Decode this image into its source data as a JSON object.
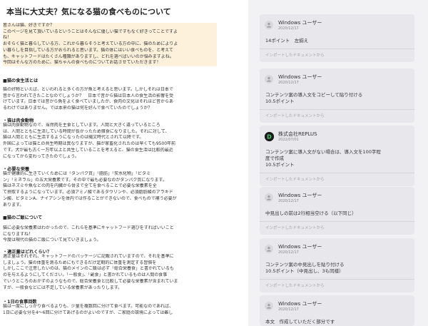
{
  "document": {
    "title": "本当に大丈夫？気になる猫の食べものについて",
    "intro_lines": [
      "皆さんは猫、好きですか？",
      "このページを見て頂いているということはそんなに優しい猫ですもなく好きってことですよ",
      "ね！",
      "おそらく猫と暮らしている方、これから暮らそうと考えている方の中に、猫のためによりよ",
      "い暮らしを目指している方がおられると思います。猫の体にはいい食べものを、と考えて",
      "も、キャットフードはたくさん種類がありますし、どれを選べばいいのか悩みますよね。",
      "今回はそんな方のために、猫ちゃんの食べものについてお話させていただきます！"
    ],
    "sections": [
      {
        "heading": "■猫の食生活とは",
        "lines": [
          "猫の好物といえば、といわれると多くの方が魚と考えると思います。しかしそれは日本で",
          "昔から言われてきたことなのでしょうか？　日本で昔から猫は日本人の食生活の影響を受",
          "けています。日本では昔から魚をよく食べていましたが、食肉の文化はそれほど昔からあ",
          "るわけではありません。では本来の猫は何を好んで食べていたのでしょうか？"
        ]
      },
      {
        "heading": "・猫は肉食動物",
        "lines": [
          "猫は肉食動物なので、当然肉を主食としています。人間と大きく違っているところ",
          "は、人間とともに生活している時間が長かったため雑食になりました。それに対して、",
          "猫は人間とともに生活するようになったのは縄文時代とされて以降です。",
          "外国によっては猫との共生時期は異なりますが、猫が家畜化されたのは早くても9500年前",
          "です。犬が最も古く一万年以上と共生していることを考えると、猫の食生活は比較的最近",
          "になってから変わってきたのでしょう。"
        ]
      },
      {
        "heading": "・必要な栄養",
        "lines": [
          "猫が健康的に生きていくためには「タンパク質」「脂肪」「炭水化物」「ビタミ",
          "ン」「ミネラル」の五大栄養素です。その中で最も必要なのがタンパク質になります。",
          "猫はネズミや魚などの肉を内臓から骨まで全てを食べることで必要な栄養素を全",
          "て摂取するようになっています。必須アミノ酸であるタウリンや、必須脂肪酸のアラキド",
          "ン酸、ビタミンA、ナイアシンを体内では作ることができないので、食べもので補う必要が",
          "あります。"
        ]
      },
      {
        "heading": "■猫のご飯について",
        "lines": [
          "猫に必要な栄養素はわかったので、これらを基準にキャットフード選びをすればいいこと",
          "になりますね！",
          "今度は現代の猫のご飯について見ていきましょう。"
        ]
      },
      {
        "heading": "・適正量はどれくらい？",
        "lines": [
          "適正量はそれぞれ、キャットフードのパッケージに記載されていますので、それを基準に",
          "しましょう。猫の体重を測るためにもできるだけ定期的に体重を測定する習慣を",
          "しかしここで注意したいのは、猫のメインのご飯は必ず「総合栄養食」と書かれているも",
          "のを与えるようにしてください。「一般食」、「副食」と書かれているものは人間の食事",
          "でいうところのおかずのようなもので、総合栄養食と比較して必要な栄養素が含まれていま",
          "すが、一般食などには不足している栄養素があったりします。"
        ]
      },
      {
        "heading": "・1日の食事回数",
        "lines": [
          "猫は一度にしっかり食べるよりも、少量を複数回に分けて食べます。可能なのであれば、",
          "1日に必要な分を4〜6回に分けてあげるのがよいのですが、ご家庭の環境によっては難し"
        ]
      }
    ]
  },
  "sidebar": {
    "import_link_label": "インポートしたドキュメントから",
    "comments": [
      {
        "author": "Windows ユーザー",
        "date": "2020/12/17",
        "icon": "user-icon",
        "lines": [
          "14ポイント　左揃え"
        ]
      },
      {
        "author": "Windows ユーザー",
        "date": "2020/12/17",
        "icon": "user-icon",
        "lines": [
          "コンテンツ案の導入文をコピーして貼り付ける",
          "10.5ポイント"
        ]
      },
      {
        "author": "株式会社REPLUS",
        "date": "2022/07/01",
        "icon": "replus-logo-icon",
        "lines": [
          "コンテンツ案に導入文がない場合は、導入文を100字程",
          "度で作成",
          "10.5ポイント"
        ]
      },
      {
        "author": "Windows ユーザー",
        "date": "2020/12/17",
        "icon": "user-icon",
        "lines": [
          "中見出しの前は2行相当空ける（以下同じ）"
        ]
      },
      {
        "author": "Windows ユーザー",
        "date": "2020/12/17",
        "icon": "user-icon",
        "lines": [
          "コンテンツ案の中見出しを貼り付ける",
          "10.5ポイント（中見出し、3も同様）"
        ]
      },
      {
        "author": "Windows ユーザー",
        "date": "2020/12/17",
        "icon": "user-icon",
        "lines": [
          "本文　作成していただく部分です"
        ]
      }
    ]
  }
}
